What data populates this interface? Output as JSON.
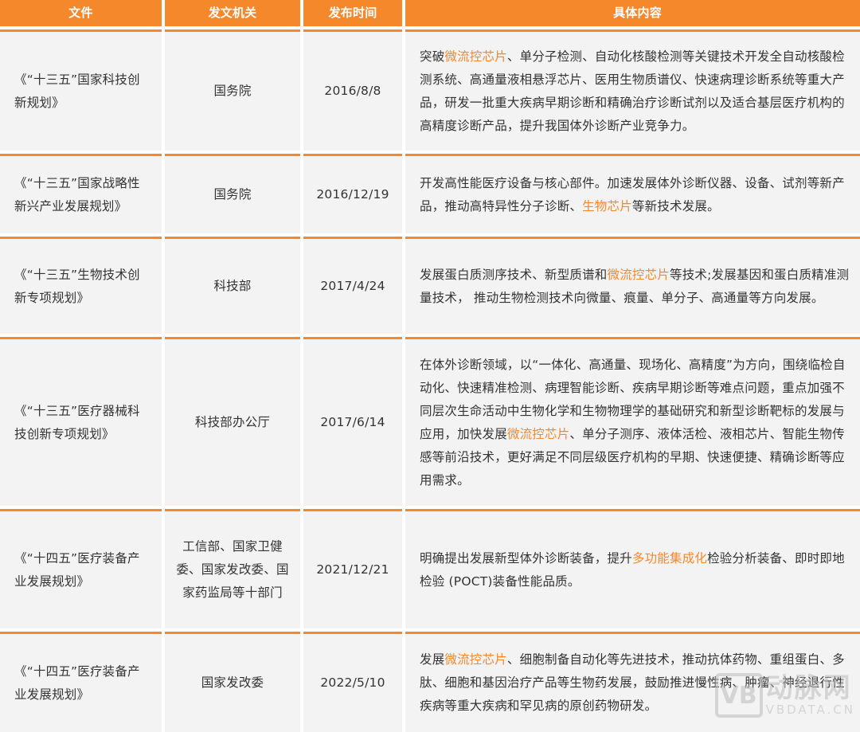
{
  "header": {
    "col1": "文件",
    "col2": "发文机关",
    "col3": "发布时间",
    "col4": "具体内容"
  },
  "rows": [
    {
      "doc": "《“十三五”国家科技创新规划》",
      "issuer": "国务院",
      "date": "2016/8/8",
      "content_parts": [
        {
          "t": "突破",
          "h": false
        },
        {
          "t": "微流控芯片",
          "h": true
        },
        {
          "t": "、单分子检测、自动化核酸检测等关键技术开发全自动核酸检测系统、高通量液相悬浮芯片、医用生物质谱仪、快速病理诊断系统等重大产品，研发一批重大疾病早期诊断和精确治疗诊断试剂以及适合基层医疗机构的高精度诊断产品，提升我国体外诊断产业竞争力。",
          "h": false
        }
      ]
    },
    {
      "doc": "《“十三五”国家战略性新兴产业发展规划》",
      "issuer": "国务院",
      "date": "2016/12/19",
      "content_parts": [
        {
          "t": "开发高性能医疗设备与核心部件。加速发展体外诊断仪器、设备、试剂等新产品，推动高特异性分子诊断、",
          "h": false
        },
        {
          "t": "生物芯片",
          "h": true
        },
        {
          "t": "等新技术发展。",
          "h": false
        }
      ]
    },
    {
      "doc": "《“十三五”生物技术创新专项规划》",
      "issuer": "科技部",
      "date": "2017/4/24",
      "content_parts": [
        {
          "t": "发展蛋白质测序技术、新型质谱和",
          "h": false
        },
        {
          "t": "微流控芯片",
          "h": true
        },
        {
          "t": "等技术;发展基因和蛋白质精准测量技术， 推动生物检测技术向微量、痕量、单分子、高通量等方向发展。",
          "h": false
        }
      ]
    },
    {
      "doc": "《“十三五”医疗器械科技创新专项规划》",
      "issuer": "科技部办公厅",
      "date": "2017/6/14",
      "content_parts": [
        {
          "t": "在体外诊断领域，以“一体化、高通量、现场化、高精度”为方向，围绕临检自动化、快速精准检测、病理智能诊断、疾病早期诊断等难点问题，重点加强不同层次生命活动中生物化学和生物物理学的基础研究和新型诊断靶标的发展与应用，加快发展",
          "h": false
        },
        {
          "t": "微流控芯片",
          "h": true
        },
        {
          "t": "、单分子测序、液体活检、液相芯片、智能生物传感等前沿技术，更好满足不同层级医疗机构的早期、快速便捷、精确诊断等应用需求。",
          "h": false
        }
      ]
    },
    {
      "doc": "《“十四五”医疗装备产业发展规划》",
      "issuer": "工信部、国家卫健委、国家发改委、国家药监局等十部门",
      "date": "2021/12/21",
      "content_parts": [
        {
          "t": "明确提出发展新型体外诊断装备，提升",
          "h": false
        },
        {
          "t": "多功能集成化",
          "h": true
        },
        {
          "t": "检验分析装备、即时即地检验 (POCT)装备性能品质。",
          "h": false
        }
      ]
    },
    {
      "doc": "《“十四五”医疗装备产业发展规划》",
      "issuer": "国家发改委",
      "date": "2022/5/10",
      "content_parts": [
        {
          "t": "发展",
          "h": false
        },
        {
          "t": "微流控芯片",
          "h": true
        },
        {
          "t": "、细胞制备自动化等先进技术，推动抗体药物、重组蛋白、多肽、细胞和基因治疗产品等生物药发展，鼓励推进慢性病、肿瘤、神经退行性疾病等重大疾病和罕见病的原创药物研发。",
          "h": false
        }
      ]
    }
  ],
  "watermark": {
    "logo": "VB",
    "cn": "动脉网",
    "en": "VBDATA.CN"
  },
  "colors": {
    "accent": "#f4882b",
    "cell_bg": "#f3f3f3",
    "text": "#333333"
  }
}
